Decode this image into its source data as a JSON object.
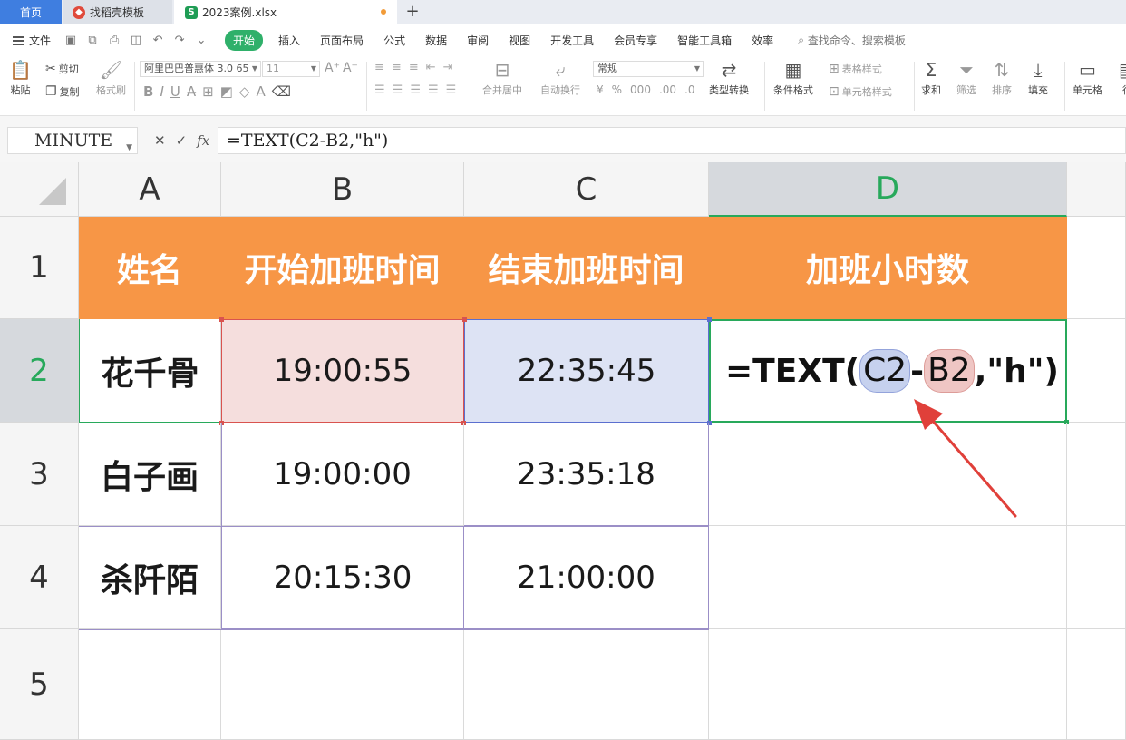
{
  "tabs": {
    "home": "首页",
    "template": "找稻壳模板",
    "file": "2023案例.xlsx",
    "new_tab": "+"
  },
  "menu": {
    "file": "文件",
    "items": [
      "开始",
      "插入",
      "页面布局",
      "公式",
      "数据",
      "审阅",
      "视图",
      "开发工具",
      "会员专享",
      "智能工具箱",
      "效率"
    ],
    "active_index": 0,
    "search": "查找命令、搜索模板"
  },
  "ribbon": {
    "paste": "粘贴",
    "cut": "剪切",
    "copy": "复制",
    "format_painter": "格式刷",
    "font_name": "阿里巴巴普惠体 3.0 65",
    "font_size": "11",
    "merge_center": "合并居中",
    "wrap_text": "自动换行",
    "number_format": "常规",
    "type_convert": "类型转换",
    "conditional_format": "条件格式",
    "table_style": "表格样式",
    "cell_style": "单元格样式",
    "sum": "求和",
    "filter": "筛选",
    "sort": "排序",
    "fill": "填充",
    "cell": "单元格",
    "row_col": "行"
  },
  "formula_bar": {
    "name_box": "MINUTE",
    "fx": "fx",
    "formula": "=TEXT(C2-B2,\"h\")"
  },
  "sheet": {
    "columns": [
      "A",
      "B",
      "C",
      "D"
    ],
    "rows": [
      "1",
      "2",
      "3",
      "4",
      "5"
    ],
    "headers": [
      "姓名",
      "开始加班时间",
      "结束加班时间",
      "加班小时数"
    ],
    "records": [
      {
        "name": "花千骨",
        "start": "19:00:55",
        "end": "22:35:45"
      },
      {
        "name": "白子画",
        "start": "19:00:00",
        "end": "23:35:18"
      },
      {
        "name": "杀阡陌",
        "start": "20:15:30",
        "end": "21:00:00"
      }
    ],
    "editing": {
      "prefix": "=TEXT(",
      "ref1": "C2",
      "op": "-",
      "ref2": "B2",
      "suffix": ",\"h\")"
    }
  },
  "colors": {
    "header_fill": "#f79646",
    "active_green": "#28a95b",
    "ref_red": "#d9534f",
    "ref_blue": "#5b6fcf",
    "arrow": "#e0403a"
  }
}
